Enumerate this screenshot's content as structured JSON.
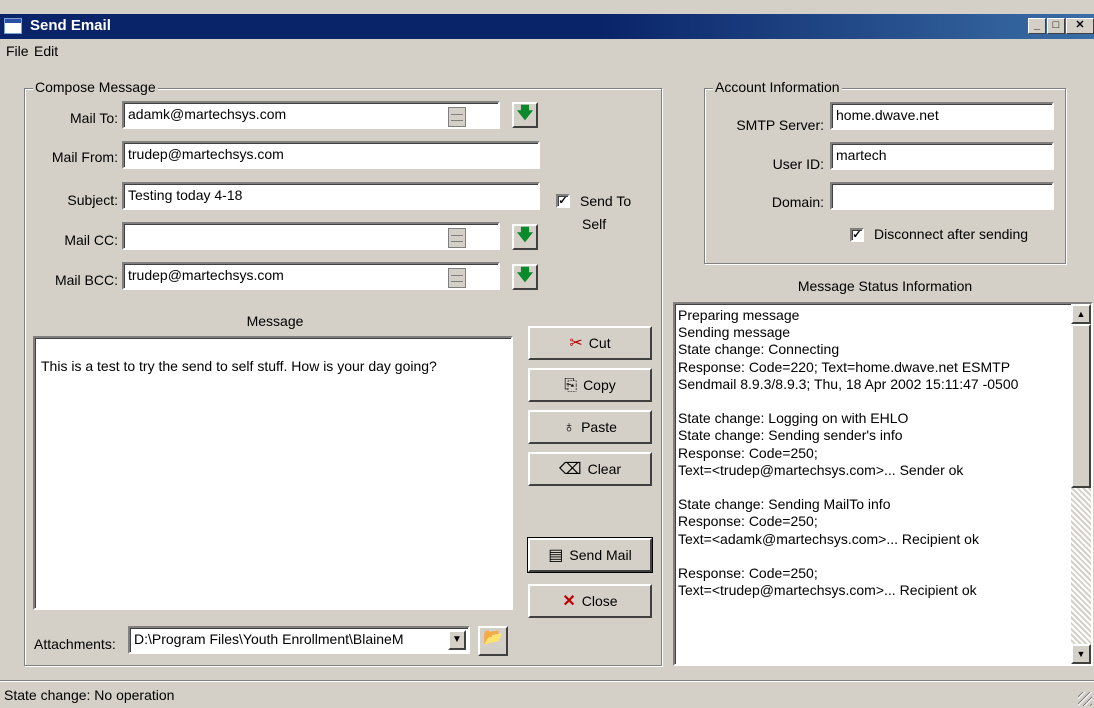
{
  "window": {
    "title": "Send Email"
  },
  "menu": [
    {
      "label": "File"
    },
    {
      "label": "Edit"
    }
  ],
  "compose": {
    "group_label": "Compose Message",
    "mail_to_label": "Mail To:",
    "mail_to_value": "adamk@martechsys.com",
    "mail_from_label": "Mail From:",
    "mail_from_value": "trudep@martechsys.com",
    "subject_label": "Subject:",
    "subject_value": "Testing today 4-18",
    "mail_cc_label": "Mail CC:",
    "mail_cc_value": "",
    "mail_bcc_label": "Mail BCC:",
    "mail_bcc_value": "trudep@martechsys.com",
    "send_to_self_line1": "Send To",
    "send_to_self_line2": "Self",
    "send_to_self_checked": true,
    "message_label": "Message",
    "message_text": "This is a test to try the send to self stuff.  How is your day going?",
    "attachments_label": "Attachments:",
    "attachments_value": "D:\\Program Files\\Youth Enrollment\\BlaineM"
  },
  "buttons": {
    "cut": "Cut",
    "copy": "Copy",
    "paste": "Paste",
    "clear": "Clear",
    "send": "Send Mail",
    "close": "Close"
  },
  "account": {
    "group_label": "Account Information",
    "smtp_label": "SMTP Server:",
    "smtp_value": "home.dwave.net",
    "user_label": "User ID:",
    "user_value": "martech",
    "domain_label": "Domain:",
    "domain_value": "",
    "disconnect_label": "Disconnect after sending",
    "disconnect_checked": true
  },
  "status_info": {
    "label": "Message Status Information",
    "lines": [
      "Preparing message",
      "Sending message",
      "State change: Connecting",
      "Response: Code=220; Text=home.dwave.net ESMTP",
      "Sendmail 8.9.3/8.9.3; Thu, 18 Apr 2002 15:11:47 -0500",
      "",
      "State change: Logging on with EHLO",
      "State change: Sending sender's info",
      "Response: Code=250;",
      "Text=<trudep@martechsys.com>... Sender ok",
      "",
      "State change: Sending MailTo info",
      "Response: Code=250;",
      "Text=<adamk@martechsys.com>... Recipient ok",
      "",
      "Response: Code=250;",
      "Text=<trudep@martechsys.com>... Recipient ok"
    ]
  },
  "statusbar": {
    "text": "State change: No operation"
  }
}
